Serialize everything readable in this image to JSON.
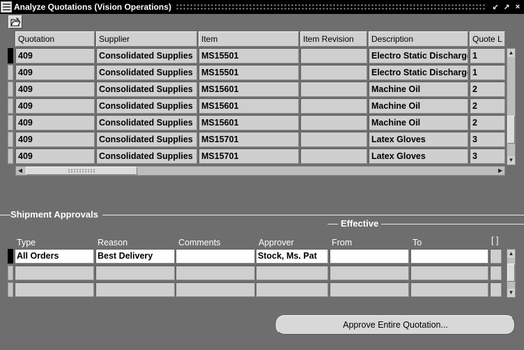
{
  "window": {
    "title": "Analyze Quotations (Vision Operations)",
    "minimize_glyph": "↙",
    "maximize_glyph": "↗",
    "close_glyph": "×"
  },
  "toolbar": {
    "icon": "open-folder-icon"
  },
  "quotes_grid": {
    "headers": [
      "Quotation",
      "Supplier",
      "Item",
      "Item Revision",
      "Description",
      "Quote L"
    ],
    "rows": [
      [
        "409",
        "Consolidated Supplies",
        "MS15501",
        "",
        "Electro Static Discharge",
        "1"
      ],
      [
        "409",
        "Consolidated Supplies",
        "MS15501",
        "",
        "Electro Static Discharge",
        "1"
      ],
      [
        "409",
        "Consolidated Supplies",
        "MS15601",
        "",
        "Machine Oil",
        "2"
      ],
      [
        "409",
        "Consolidated Supplies",
        "MS15601",
        "",
        "Machine Oil",
        "2"
      ],
      [
        "409",
        "Consolidated Supplies",
        "MS15601",
        "",
        "Machine Oil",
        "2"
      ],
      [
        "409",
        "Consolidated Supplies",
        "MS15701",
        "",
        "Latex Gloves",
        "3"
      ],
      [
        "409",
        "Consolidated Supplies",
        "MS15701",
        "",
        "Latex Gloves",
        "3"
      ]
    ]
  },
  "shipment": {
    "title": "Shipment Approvals",
    "effective_label": "Effective",
    "headers": [
      "Type",
      "Reason",
      "Comments",
      "Approver",
      "From",
      "To"
    ],
    "bracket": "[ ]",
    "rows": [
      [
        "All Orders",
        "Best Delivery",
        "",
        "Stock, Ms. Pat",
        "",
        ""
      ],
      [
        "",
        "",
        "",
        "",
        "",
        ""
      ],
      [
        "",
        "",
        "",
        "",
        "",
        ""
      ]
    ]
  },
  "actions": {
    "approve_label": "Approve Entire Quotation..."
  }
}
